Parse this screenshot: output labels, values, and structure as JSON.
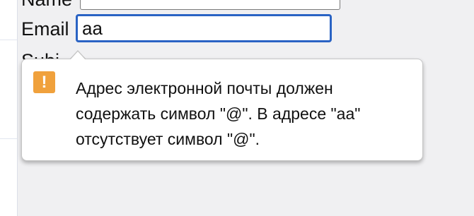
{
  "form": {
    "name_label": "Name",
    "email_label": "Email",
    "email_value": "aa",
    "partially_hidden_label": "Subj"
  },
  "validation_bubble": {
    "icon": "warning-icon",
    "icon_glyph": "!",
    "icon_color": "#f0a13c",
    "message": "Адрес электронной почты должен содержать символ \"@\". В адресе \"aa\" отсутствует символ \"@\"."
  },
  "colors": {
    "focus_border": "#2a63c4"
  }
}
